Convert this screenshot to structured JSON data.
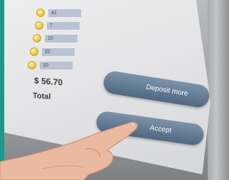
{
  "coins": [
    {
      "qty": "41"
    },
    {
      "qty": "7"
    },
    {
      "qty": "10"
    },
    {
      "qty": "22"
    },
    {
      "qty": "10"
    }
  ],
  "summary": {
    "amount": "$ 56.70",
    "total_label": "Total"
  },
  "buttons": {
    "deposit_more": "Deposit more",
    "accept": "Accept"
  },
  "colors": {
    "screen": "#e6e6e8",
    "button": "#5f7891",
    "coin": "#e5c53c",
    "accent_strip": "#1a9a8a"
  }
}
